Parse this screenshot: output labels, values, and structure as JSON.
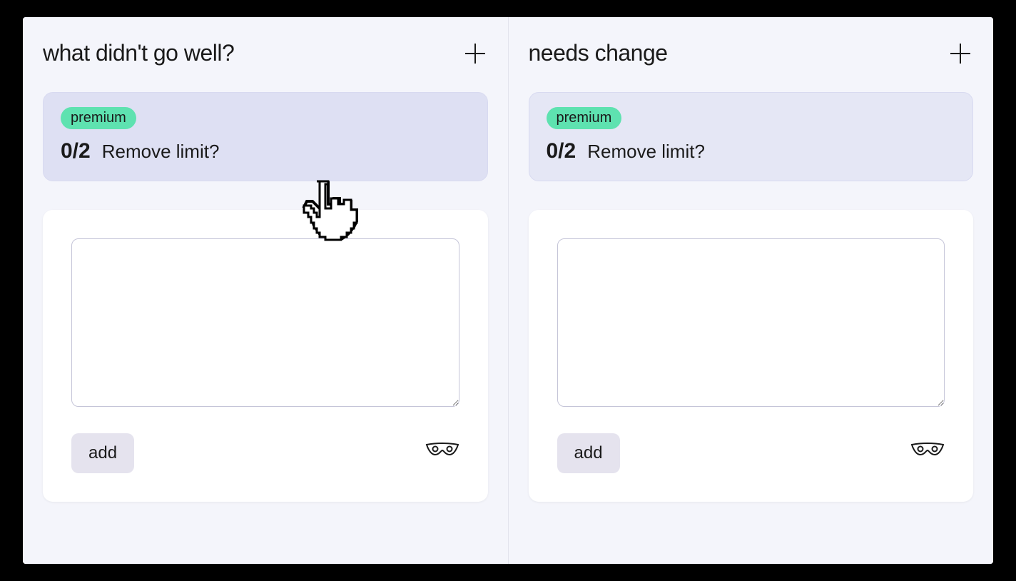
{
  "columns": [
    {
      "title": "what didn't go well?",
      "premium_label": "premium",
      "limit_count": "0/2",
      "remove_limit": "Remove limit?",
      "add_label": "add",
      "textarea_value": "",
      "hover": true
    },
    {
      "title": "needs change",
      "premium_label": "premium",
      "limit_count": "0/2",
      "remove_limit": "Remove limit?",
      "add_label": "add",
      "textarea_value": "",
      "hover": false
    }
  ]
}
